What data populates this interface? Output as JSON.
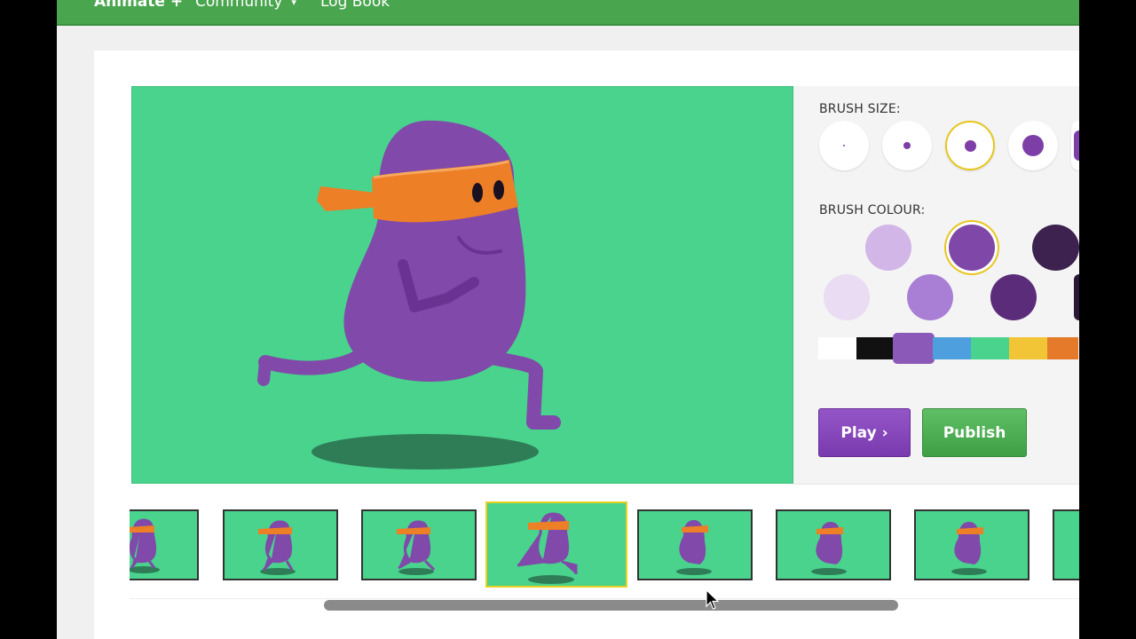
{
  "nav": {
    "items": [
      {
        "label": "Animate +",
        "bold": true
      },
      {
        "label": "Community",
        "caret": "▾"
      },
      {
        "label": "Log Book"
      }
    ]
  },
  "tools": {
    "brush_size_label": "BRUSH SIZE:",
    "brush_sizes": [
      "tiny",
      "small",
      "medium",
      "large",
      "x-large"
    ],
    "selected_brush_size_index": 2,
    "brush_colour_label": "BRUSH COLOUR:",
    "colour_swatches": [
      "#d1b6e7",
      "#7e47a8",
      "#3d224f",
      "#e9dcf3",
      "#a97ed5",
      "#5b2c7a",
      "#2a1736"
    ],
    "selected_swatch": "#7e47a8",
    "palette": [
      "#ffffff",
      "#111111",
      "#8b5ab8",
      "#4d9fde",
      "#49d38d",
      "#f2c537",
      "#e57a2b"
    ],
    "selected_palette_index": 2
  },
  "actions": {
    "play_label": "Play ›",
    "publish_label": "Publish"
  },
  "timeline": {
    "frame_count_visible": 8,
    "current_frame_index": 3
  },
  "colors": {
    "nav_green": "#4aa54f",
    "canvas_green": "#49d38d",
    "character_purple": "#8149a9",
    "headband_orange": "#ed7f26",
    "shadow_green": "#2f7d57",
    "selection_yellow": "#e7c61f"
  }
}
